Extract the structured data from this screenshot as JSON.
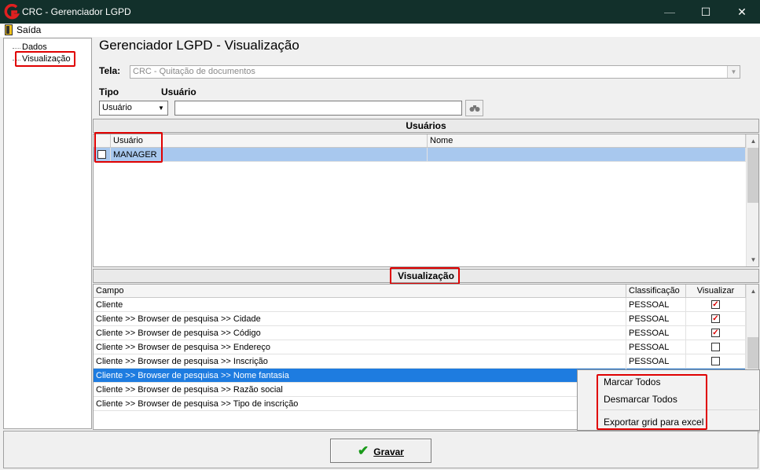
{
  "window": {
    "title": "CRC - Gerenciador LGPD",
    "controls": {
      "minimize": "—",
      "maximize": "☐",
      "close": "✕"
    }
  },
  "menu": {
    "saida": "Saída"
  },
  "tree": {
    "items": [
      "Dados",
      "Visualização"
    ],
    "selected": "Visualização"
  },
  "page_title": "Gerenciador LGPD - Visualização",
  "tela": {
    "label": "Tela:",
    "value": "CRC - Quitação de documentos"
  },
  "filters": {
    "tipo_label": "Tipo",
    "usuario_label": "Usuário",
    "tipo_value": "Usuário",
    "usuario_value": ""
  },
  "usuarios": {
    "header": "Usuários",
    "columns": [
      "Usuário",
      "Nome"
    ],
    "rows": [
      {
        "checked": false,
        "usuario": "MANAGER",
        "nome": ""
      }
    ]
  },
  "visualizacao": {
    "header": "Visualização",
    "columns": [
      "Campo",
      "Classificação",
      "Visualizar"
    ],
    "rows": [
      {
        "campo": "Cliente",
        "classificacao": "PESSOAL",
        "visualizar": true
      },
      {
        "campo": "Cliente >> Browser de pesquisa >> Cidade",
        "classificacao": "PESSOAL",
        "visualizar": true
      },
      {
        "campo": "Cliente >> Browser de pesquisa >> Código",
        "classificacao": "PESSOAL",
        "visualizar": true
      },
      {
        "campo": "Cliente >> Browser de pesquisa >> Endereço",
        "classificacao": "PESSOAL",
        "visualizar": false
      },
      {
        "campo": "Cliente >> Browser de pesquisa >> Inscrição",
        "classificacao": "PESSOAL",
        "visualizar": false
      },
      {
        "campo": "Cliente >> Browser de pesquisa >> Nome fantasia",
        "classificacao": "",
        "visualizar": null
      },
      {
        "campo": "Cliente >> Browser de pesquisa >> Razão social",
        "classificacao": "",
        "visualizar": null
      },
      {
        "campo": "Cliente >> Browser de pesquisa >> Tipo de inscrição",
        "classificacao": "",
        "visualizar": null
      }
    ]
  },
  "context_menu": {
    "items": [
      "Marcar Todos",
      "Desmarcar Todos",
      "Exportar grid para excel"
    ]
  },
  "buttons": {
    "gravar": "Gravar"
  },
  "colors": {
    "titlebar": "#12302b",
    "selection": "#1e7ce0",
    "highlight": "#e00000",
    "check": "#d00000"
  }
}
